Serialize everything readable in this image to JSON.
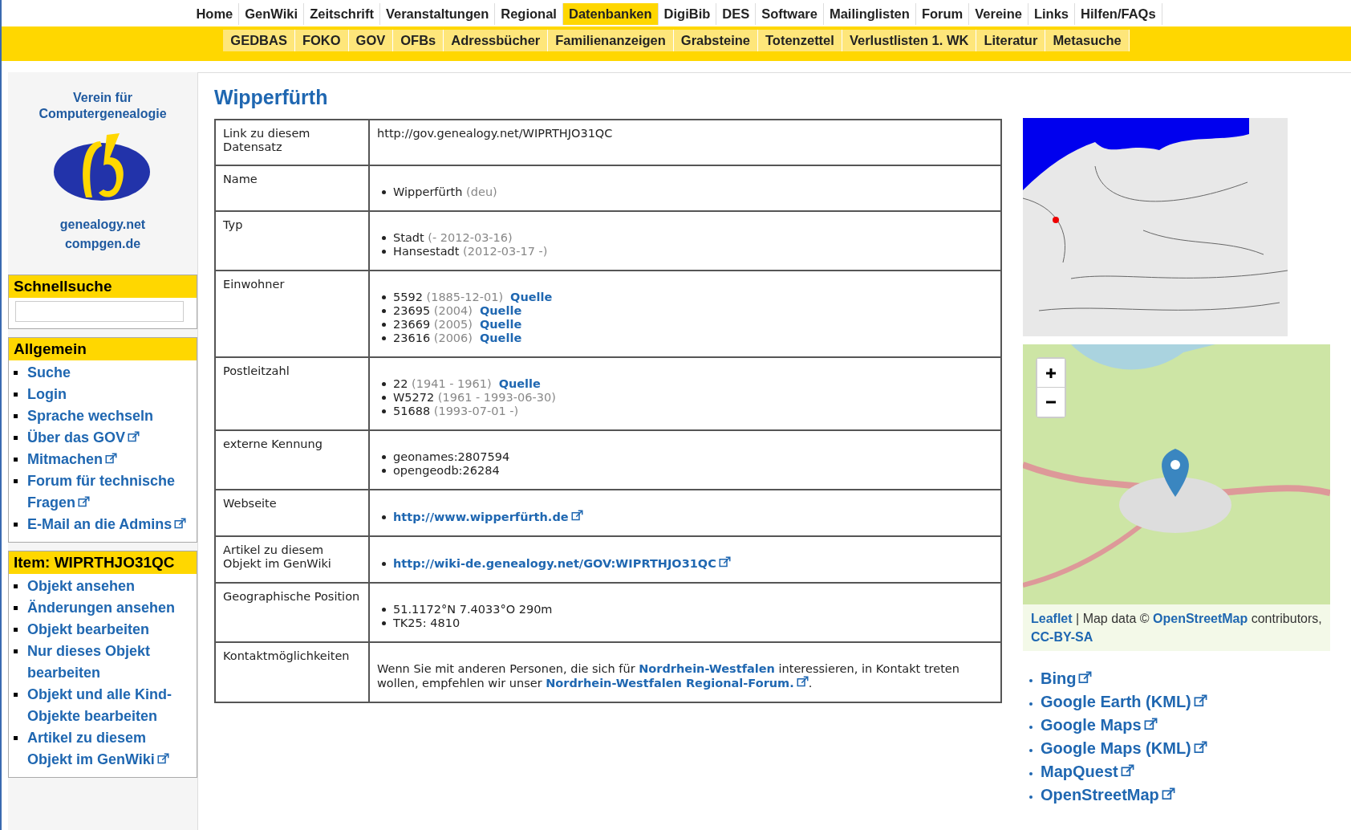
{
  "top_nav": [
    {
      "label": "Home",
      "selected": false
    },
    {
      "label": "GenWiki",
      "selected": false
    },
    {
      "label": "Zeitschrift",
      "selected": false
    },
    {
      "label": "Veranstaltungen",
      "selected": false
    },
    {
      "label": "Regional",
      "selected": false
    },
    {
      "label": "Datenbanken",
      "selected": true
    },
    {
      "label": "DigiBib",
      "selected": false
    },
    {
      "label": "DES",
      "selected": false
    },
    {
      "label": "Software",
      "selected": false
    },
    {
      "label": "Mailinglisten",
      "selected": false
    },
    {
      "label": "Forum",
      "selected": false
    },
    {
      "label": "Vereine",
      "selected": false
    },
    {
      "label": "Links",
      "selected": false
    },
    {
      "label": "Hilfen/FAQs",
      "selected": false
    }
  ],
  "sub_nav": [
    {
      "label": "GEDBAS"
    },
    {
      "label": "FOKO"
    },
    {
      "label": "GOV"
    },
    {
      "label": "OFBs"
    },
    {
      "label": "Adressbücher"
    },
    {
      "label": "Familienanzeigen"
    },
    {
      "label": "Grabsteine"
    },
    {
      "label": "Totenzettel"
    },
    {
      "label": "Verlustlisten 1. WK"
    },
    {
      "label": "Literatur"
    },
    {
      "label": "Metasuche"
    }
  ],
  "logo": {
    "title": "Verein für Computergenealogie",
    "domains": [
      "genealogy.net",
      "compgen.de"
    ]
  },
  "sidebar": [
    {
      "title": "Schnellsuche",
      "kind": "search"
    },
    {
      "title": "Allgemein",
      "kind": "links",
      "items": [
        {
          "label": "Suche",
          "external": false
        },
        {
          "label": "Login",
          "external": false
        },
        {
          "label": "Sprache wechseln",
          "external": false
        },
        {
          "label": "Über das GOV",
          "external": true
        },
        {
          "label": "Mitmachen",
          "external": true
        },
        {
          "label": "Forum für technische Fragen",
          "external": true
        },
        {
          "label": "E-Mail an die Admins",
          "external": true
        }
      ]
    },
    {
      "title": "Item: WIPRTHJO31QC",
      "kind": "links",
      "items": [
        {
          "label": "Objekt ansehen",
          "external": false
        },
        {
          "label": "Änderungen ansehen",
          "external": false
        },
        {
          "label": "Objekt bearbeiten",
          "external": false
        },
        {
          "label": "Nur dieses Objekt bearbeiten",
          "external": false
        },
        {
          "label": "Objekt und alle Kind-Objekte bearbeiten",
          "external": false
        },
        {
          "label": "Artikel zu diesem Objekt im GenWiki",
          "external": true
        }
      ]
    }
  ],
  "page_title": "Wipperfürth",
  "table": [
    {
      "label": "Link zu diesem Datensatz",
      "kind": "text",
      "text": "http://gov.genealogy.net/WIPRTHJO31QC"
    },
    {
      "label": "Name",
      "kind": "list",
      "items": [
        {
          "value": "Wipperfürth",
          "note": "(deu)"
        }
      ]
    },
    {
      "label": "Typ",
      "kind": "list",
      "items": [
        {
          "value": "Stadt",
          "note": "(- 2012-03-16)"
        },
        {
          "value": "Hansestadt",
          "note": "(2012-03-17 -)"
        }
      ]
    },
    {
      "label": "Einwohner",
      "kind": "list",
      "items": [
        {
          "value": "5592",
          "note": "(1885-12-01)",
          "link": "Quelle"
        },
        {
          "value": "23695",
          "note": "(2004)",
          "link": "Quelle"
        },
        {
          "value": "23669",
          "note": "(2005)",
          "link": "Quelle"
        },
        {
          "value": "23616",
          "note": "(2006)",
          "link": "Quelle"
        }
      ]
    },
    {
      "label": "Postleitzahl",
      "kind": "list",
      "items": [
        {
          "value": "22",
          "note": "(1941 - 1961)",
          "link": "Quelle"
        },
        {
          "value": "W5272",
          "note": "(1961 - 1993-06-30)"
        },
        {
          "value": "51688",
          "note": "(1993-07-01 -)"
        }
      ]
    },
    {
      "label": "externe Kennung",
      "kind": "list",
      "items": [
        {
          "value": "geonames:2807594"
        },
        {
          "value": "opengeodb:26284"
        }
      ]
    },
    {
      "label": "Webseite",
      "kind": "list",
      "items": [
        {
          "link": "http://www.wipperfürth.de",
          "external": true
        }
      ]
    },
    {
      "label": "Artikel zu diesem Objekt im GenWiki",
      "kind": "list",
      "items": [
        {
          "link": "http://wiki-de.genealogy.net/GOV:WIPRTHJO31QC",
          "external": true
        }
      ]
    },
    {
      "label": "Geographische Position",
      "kind": "list",
      "items": [
        {
          "value": "51.1172°N 7.4033°O 290m"
        },
        {
          "value": "TK25: 4810"
        }
      ]
    },
    {
      "label": "Kontaktmöglichkeiten",
      "kind": "paragraph",
      "segments": [
        {
          "text": "Wenn Sie mit anderen Personen, die sich für"
        },
        {
          "link": "Nordrhein-Westfalen"
        },
        {
          "text": "interessieren, in Kontakt treten wollen, empfehlen wir unser"
        },
        {
          "link": "Nordrhein-Westfalen Regional-Forum.",
          "external": true
        },
        {
          "text": "."
        }
      ]
    }
  ],
  "map_attribution": [
    {
      "link": "Leaflet"
    },
    {
      "text": "| Map data ©"
    },
    {
      "link": "OpenStreetMap"
    },
    {
      "text": "contributors,"
    },
    {
      "link": "CC-BY-SA"
    }
  ],
  "map_links": [
    {
      "label": "Bing"
    },
    {
      "label": "Google Earth (KML)"
    },
    {
      "label": "Google Maps"
    },
    {
      "label": "Google Maps (KML)"
    },
    {
      "label": "MapQuest"
    },
    {
      "label": "OpenStreetMap"
    }
  ]
}
